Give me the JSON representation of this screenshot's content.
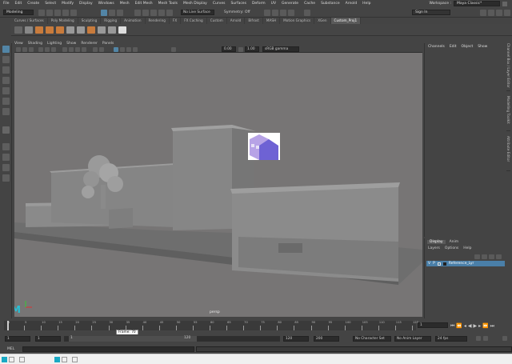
{
  "menubar": {
    "items": [
      "File",
      "Edit",
      "Create",
      "Select",
      "Modify",
      "Display",
      "Windows",
      "Mesh",
      "Edit Mesh",
      "Mesh Tools",
      "Mesh Display",
      "Curves",
      "Surfaces",
      "Deform",
      "UV",
      "Generate",
      "Cache",
      "Substance",
      "Arnold",
      "Help"
    ],
    "workspace_label": "Workspace :",
    "workspace_value": "Maya Classic*"
  },
  "statusline": {
    "mode": "Modeling",
    "live_surface": "No Live Surface",
    "symmetry": "Symmetry: Off",
    "sign_in": "Sign In"
  },
  "shelf_tabs": [
    "Curves / Surfaces",
    "Poly Modeling",
    "Sculpting",
    "Rigging",
    "Animation",
    "Rendering",
    "FX",
    "FX Caching",
    "Custom",
    "Arnold",
    "Bifrost",
    "MASH",
    "Motion Graphics",
    "XGen",
    "Custom_Proj1"
  ],
  "active_shelf_tab": "Custom_Proj1",
  "panel_menu": [
    "View",
    "Shading",
    "Lighting",
    "Show",
    "Renderer",
    "Panels"
  ],
  "panel_toolbar": {
    "exposure": "0.00",
    "gamma": "1.00",
    "color_space": "sRGB gamma"
  },
  "viewport": {
    "camera_label": "persp",
    "logo": "M"
  },
  "channel_box": {
    "menu": [
      "Channels",
      "Edit",
      "Object",
      "Show"
    ],
    "side_tabs": [
      "Channel Box / Layer Editor",
      "Modelling Toolkit",
      "Attribute Editor"
    ]
  },
  "layer_editor": {
    "tabs": [
      "Display",
      "Anim"
    ],
    "menu": [
      "Layers",
      "Options",
      "Help"
    ],
    "layer_v": "V",
    "layer_p": "P",
    "layer_name": "Reference_Lyr"
  },
  "timeline": {
    "ticks": [
      "1",
      "5",
      "10",
      "15",
      "20",
      "25",
      "30",
      "35",
      "40",
      "45",
      "50",
      "55",
      "60",
      "65",
      "70",
      "75",
      "80",
      "85",
      "90",
      "95",
      "100",
      "105",
      "110",
      "115",
      "120"
    ],
    "current_frame": "1",
    "tooltip": "Frame: 70"
  },
  "range_bar": {
    "start": "1",
    "playback_start": "1",
    "slider_start": "1",
    "slider_end": "120",
    "playback_end": "120",
    "end": "200",
    "character_set": "No Character Set",
    "anim_layer": "No Anim Layer",
    "fps": "24 fps"
  },
  "mel": {
    "label": "MEL"
  },
  "colors": {
    "accent": "#5285a6",
    "selected_layer": "#4a7fa8",
    "viewport_bg": "#777575"
  }
}
